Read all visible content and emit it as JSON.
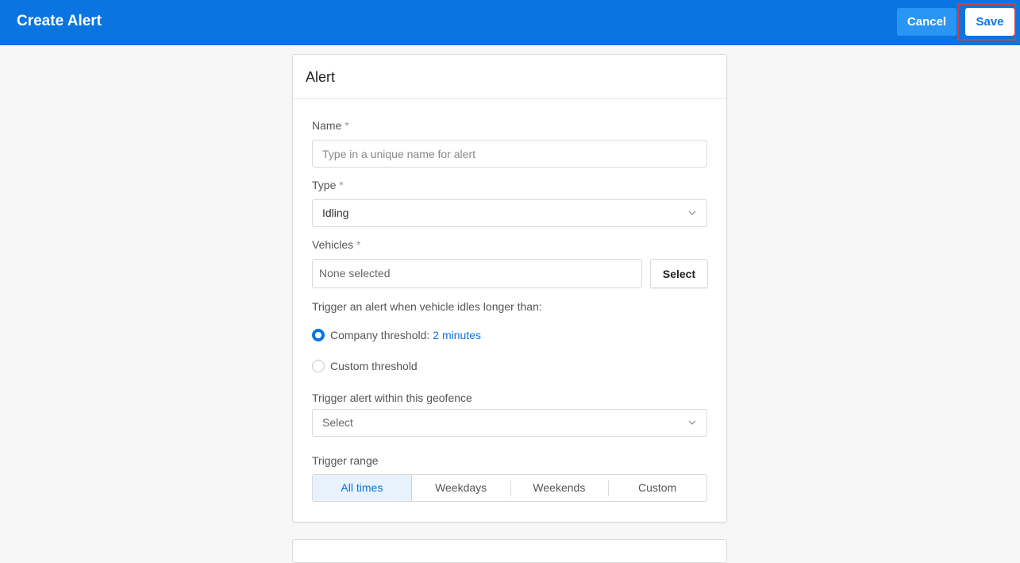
{
  "header": {
    "title": "Create Alert",
    "cancel_label": "Cancel",
    "save_label": "Save"
  },
  "card": {
    "title": "Alert",
    "name": {
      "label": "Name",
      "required": "*",
      "placeholder": "Type in a unique name for alert",
      "value": ""
    },
    "type": {
      "label": "Type",
      "required": "*",
      "value": "Idling"
    },
    "vehicles": {
      "label": "Vehicles",
      "required": "*",
      "value": "None selected",
      "select_label": "Select"
    },
    "trigger": {
      "label": "Trigger an alert when vehicle idles longer than:",
      "options": [
        {
          "label": "Company threshold:",
          "link": "2 minutes",
          "selected": true
        },
        {
          "label": "Custom threshold",
          "selected": false
        }
      ]
    },
    "geofence": {
      "label": "Trigger alert within this geofence",
      "value": "Select"
    },
    "range": {
      "label": "Trigger range",
      "options": [
        "All times",
        "Weekdays",
        "Weekends",
        "Custom"
      ],
      "selected": "All times"
    }
  },
  "colors": {
    "primary": "#0a75e0",
    "highlight": "#d93a3a"
  },
  "icons": {
    "dropdown": "chevron-down-icon"
  }
}
